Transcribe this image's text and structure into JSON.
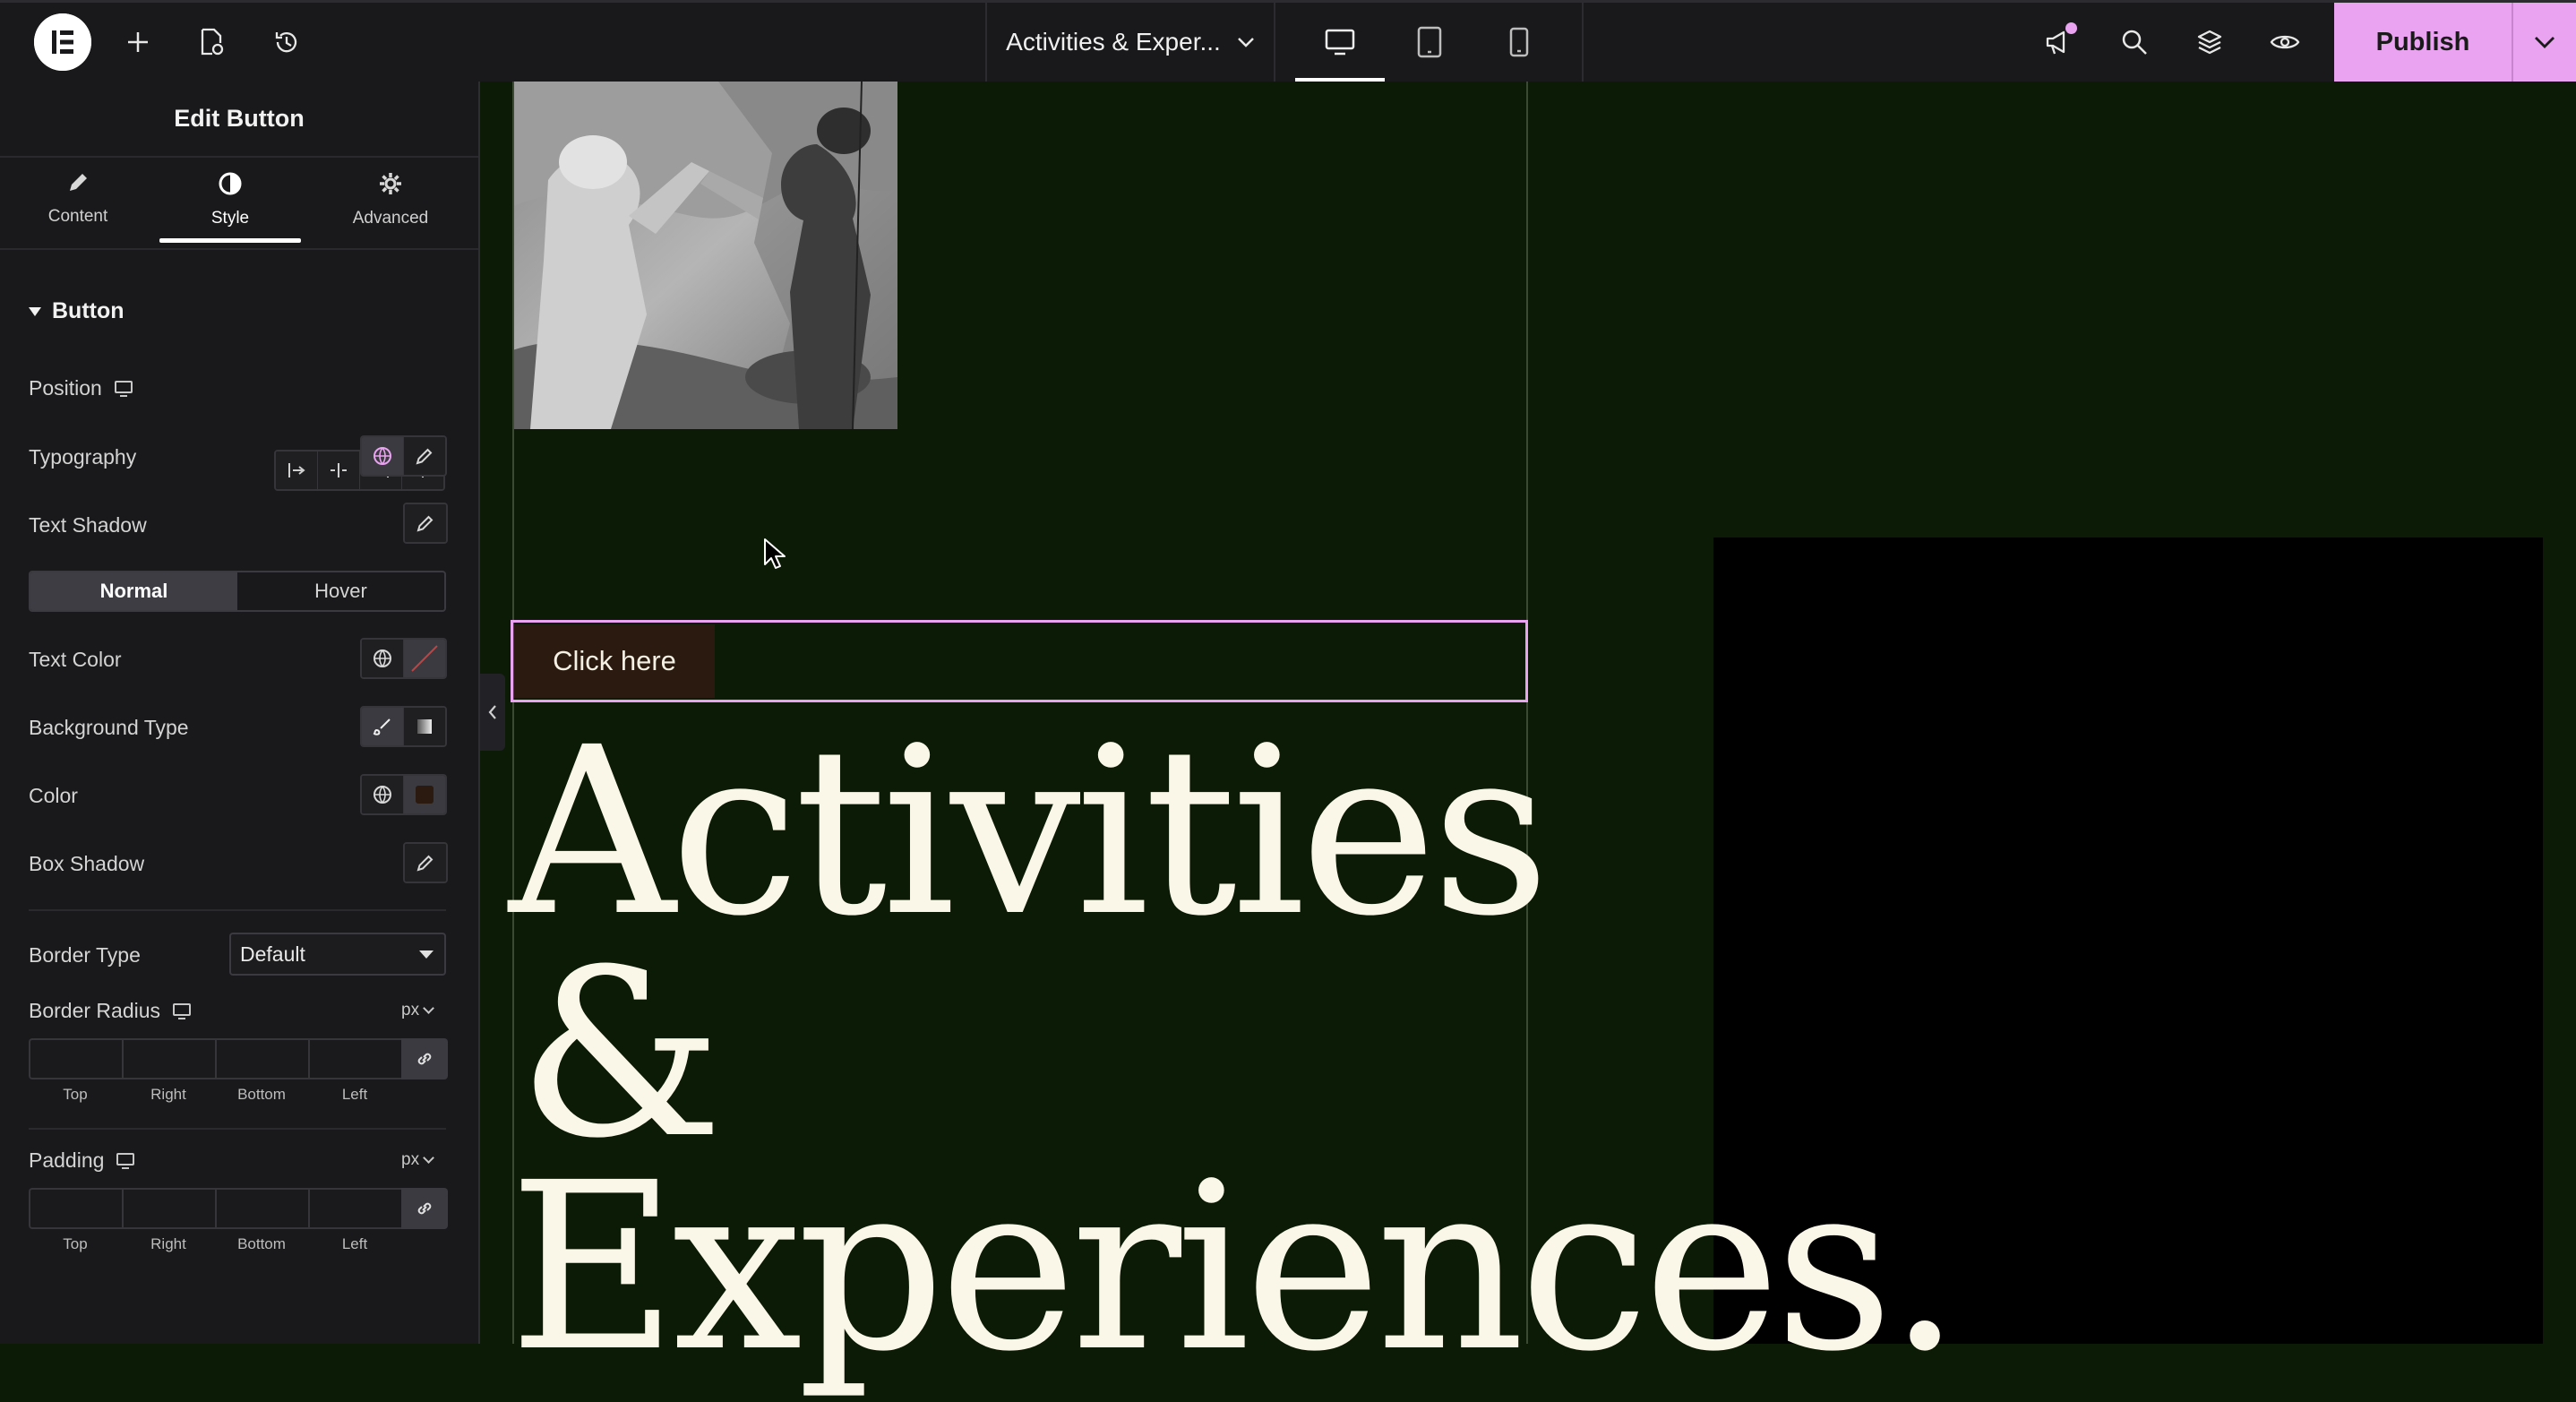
{
  "topbar": {
    "document_title": "Activities & Exper...",
    "publish_label": "Publish",
    "active_device": "desktop",
    "accent_color": "#e9a3f0"
  },
  "panel": {
    "title": "Edit Button",
    "tabs": [
      {
        "label": "Content",
        "icon": "pencil-icon"
      },
      {
        "label": "Style",
        "icon": "contrast-icon",
        "active": true
      },
      {
        "label": "Advanced",
        "icon": "gear-icon"
      }
    ],
    "section": "Button",
    "rows": {
      "position": "Position",
      "typography": "Typography",
      "text_shadow": "Text Shadow",
      "text_color": "Text Color",
      "background_type": "Background Type",
      "color": "Color",
      "box_shadow": "Box Shadow",
      "border_type": "Border Type",
      "border_radius": "Border Radius",
      "padding": "Padding"
    },
    "state_tabs": {
      "normal": "Normal",
      "hover": "Hover",
      "active": "Normal"
    },
    "border_type_value": "Default",
    "units": {
      "border_radius": "px",
      "padding": "px"
    },
    "dim_labels": [
      "Top",
      "Right",
      "Bottom",
      "Left"
    ],
    "swatch_color": "#2a1a0f"
  },
  "canvas": {
    "button_text": "Click here",
    "hero_lines": [
      "Activities",
      "&",
      "Experiences."
    ],
    "background_color": "#0c1b05",
    "hero_color": "#fbf7e8"
  }
}
